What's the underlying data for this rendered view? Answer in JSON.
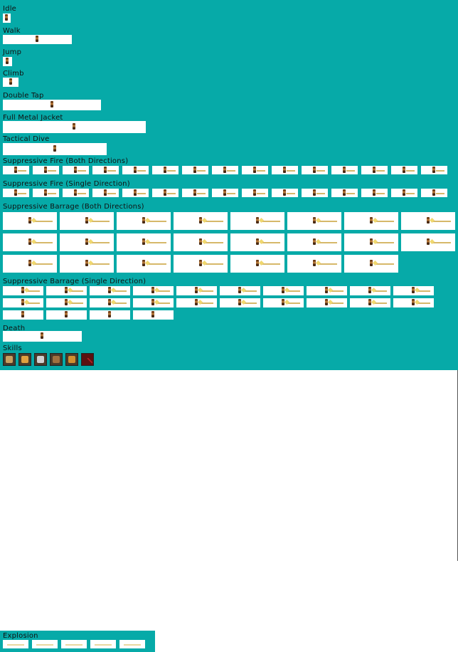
{
  "sections": {
    "idle": {
      "label": "Idle"
    },
    "walk": {
      "label": "Walk"
    },
    "jump": {
      "label": "Jump"
    },
    "climb": {
      "label": "Climb"
    },
    "double_tap": {
      "label": "Double Tap"
    },
    "full_metal_jacket": {
      "label": "Full Metal Jacket"
    },
    "tactical_dive": {
      "label": "Tactical Dive"
    },
    "suppressive_fire_both": {
      "label": "Suppressive Fire (Both Directions)"
    },
    "suppressive_fire_single": {
      "label": "Suppressive Fire (Single Direction)"
    },
    "suppressive_barrage_both": {
      "label": "Suppressive Barrage (Both Directions)"
    },
    "suppressive_barrage_single": {
      "label": "Suppressive Barrage (Single Direction)"
    },
    "death": {
      "label": "Death"
    },
    "skills": {
      "label": "Skills"
    },
    "explosion": {
      "label": "Explosion"
    }
  },
  "skill_icons": [
    {
      "icon": "double-tap-icon",
      "color": "#c8a060"
    },
    {
      "icon": "full-metal-jacket-icon",
      "color": "#e0a040"
    },
    {
      "icon": "tactical-dive-icon",
      "color": "#d0d0d0"
    },
    {
      "icon": "suppressive-fire-icon",
      "color": "#a07040"
    },
    {
      "icon": "suppressive-barrage-icon",
      "color": "#d09030"
    },
    {
      "icon": "locked-skill-icon",
      "color": "#802020"
    }
  ],
  "colors": {
    "sheet_background": "#06aaa8",
    "frame_background": "#ffffff"
  }
}
